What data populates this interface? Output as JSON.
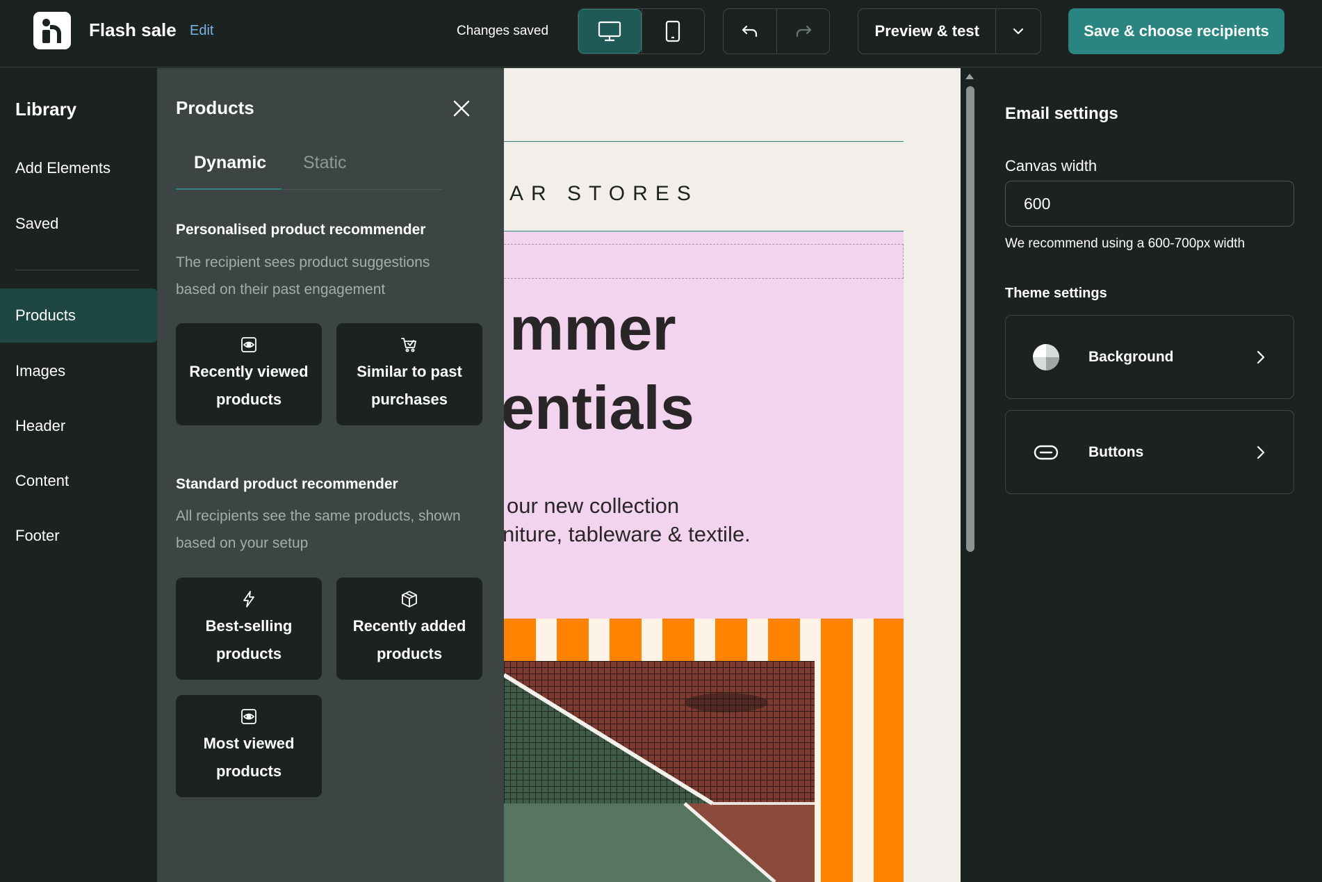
{
  "header": {
    "title": "Flash sale",
    "edit_label": "Edit",
    "status": "Changes saved",
    "preview_label": "Preview & test",
    "save_label": "Save & choose recipients"
  },
  "library": {
    "title": "Library",
    "items": [
      {
        "label": "Add Elements"
      },
      {
        "label": "Saved"
      },
      {
        "label": "Products",
        "active": true
      },
      {
        "label": "Images"
      },
      {
        "label": "Header"
      },
      {
        "label": "Content"
      },
      {
        "label": "Footer"
      }
    ]
  },
  "products_panel": {
    "title": "Products",
    "tabs": [
      {
        "label": "Dynamic",
        "active": true
      },
      {
        "label": "Static"
      }
    ],
    "personalised": {
      "title": "Personalised product recommender",
      "description": "The recipient sees product suggestions based on their past engagement",
      "cards": [
        {
          "label": "Recently viewed products",
          "icon": "eye-icon"
        },
        {
          "label": "Similar to past purchases",
          "icon": "cart-check-icon"
        }
      ]
    },
    "standard": {
      "title": "Standard product recommender",
      "description": "All recipients see the same products, shown based on your setup",
      "cards": [
        {
          "label": "Best-selling products",
          "icon": "lightning-icon"
        },
        {
          "label": "Recently added products",
          "icon": "box-icon"
        },
        {
          "label": "Most viewed products",
          "icon": "eye-icon"
        }
      ]
    }
  },
  "email": {
    "brand": "AR STORES",
    "hero_line1": "mmer",
    "hero_line2": "entials",
    "body_line1": "our new collection",
    "body_line2": "niture, tableware & textile."
  },
  "settings": {
    "title": "Email settings",
    "canvas_width_label": "Canvas width",
    "canvas_width_value": "600",
    "canvas_width_hint": "We recommend using a 600-700px width",
    "theme_title": "Theme settings",
    "theme_items": [
      {
        "label": "Background",
        "icon": "half-circle-icon"
      },
      {
        "label": "Buttons",
        "icon": "button-pill-icon"
      }
    ]
  },
  "colors": {
    "accent": "#2a8580",
    "dark_bg": "#1c2220",
    "panel_bg": "#3c4544",
    "email_pink": "#f2d4ef",
    "email_orange": "#ff8300"
  }
}
